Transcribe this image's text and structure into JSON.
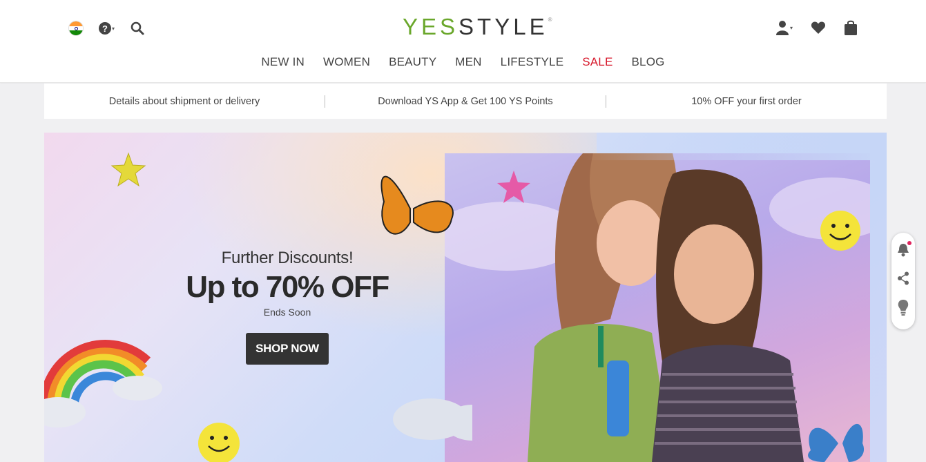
{
  "header": {
    "logo": {
      "yes": "YES",
      "style": "STYLE",
      "reg": "®"
    },
    "icons": {
      "flag": "india-flag-icon",
      "help": "help-icon",
      "search": "search-icon",
      "account": "account-icon",
      "wishlist": "heart-icon",
      "bag": "shopping-bag-icon"
    },
    "help_mark": "?",
    "caret": "▾"
  },
  "nav": {
    "items": [
      "NEW IN",
      "WOMEN",
      "BEAUTY",
      "MEN",
      "LIFESTYLE",
      "SALE",
      "BLOG"
    ],
    "sale_color": "#d7192c"
  },
  "promo_strip": {
    "items": [
      "Details about shipment or delivery",
      "Download YS App & Get 100 YS Points",
      "10% OFF your first order"
    ]
  },
  "banner": {
    "subtitle": "Further Discounts!",
    "headline": "Up to 70% OFF",
    "ends": "Ends Soon",
    "cta": "SHOP NOW"
  },
  "floating_widget": {
    "icons": [
      "bell-icon",
      "share-icon",
      "lightbulb-icon"
    ]
  },
  "colors": {
    "brand_green": "#6aa72b",
    "dark": "#333333",
    "sale_red": "#d7192c"
  }
}
